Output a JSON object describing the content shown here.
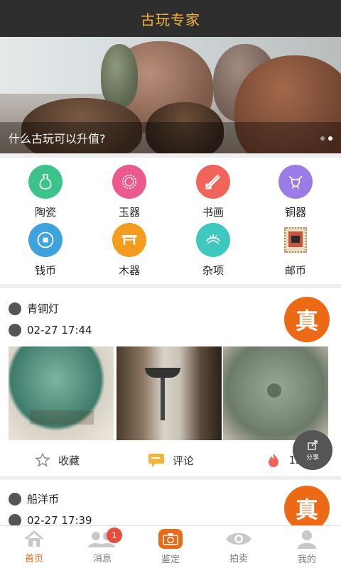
{
  "header": {
    "title": "古玩专家"
  },
  "banner": {
    "caption": "什么古玩可以升值?"
  },
  "categories": [
    {
      "label": "陶瓷",
      "icon": "vase-icon",
      "color": "#3cc38a"
    },
    {
      "label": "玉器",
      "icon": "bracelet-icon",
      "color": "#ea5a8c"
    },
    {
      "label": "书画",
      "icon": "brush-icon",
      "color": "#f0645b"
    },
    {
      "label": "铜器",
      "icon": "bronze-icon",
      "color": "#9b7be8"
    },
    {
      "label": "钱币",
      "icon": "coin-icon",
      "color": "#3ea2dc"
    },
    {
      "label": "木器",
      "icon": "table-icon",
      "color": "#f39c1d"
    },
    {
      "label": "杂项",
      "icon": "misc-icon",
      "color": "#3ec8c0"
    },
    {
      "label": "邮币",
      "icon": "stamp-icon",
      "color": "#c9a06a"
    }
  ],
  "posts": [
    {
      "title": "青铜灯",
      "time": "02-27 17:44",
      "badge": "真",
      "actions": {
        "favorite": "收藏",
        "comment": "评论",
        "count": "12"
      }
    },
    {
      "title": "船洋币",
      "time": "02-27 17:39",
      "badge": "真"
    }
  ],
  "share": {
    "label": "分享"
  },
  "tabs": [
    {
      "label": "首页",
      "icon": "home-icon"
    },
    {
      "label": "消息",
      "icon": "messages-icon",
      "badge": "1"
    },
    {
      "label": "鉴定",
      "icon": "camera-icon"
    },
    {
      "label": "拍卖",
      "icon": "eye-icon"
    },
    {
      "label": "我的",
      "icon": "profile-icon"
    }
  ]
}
